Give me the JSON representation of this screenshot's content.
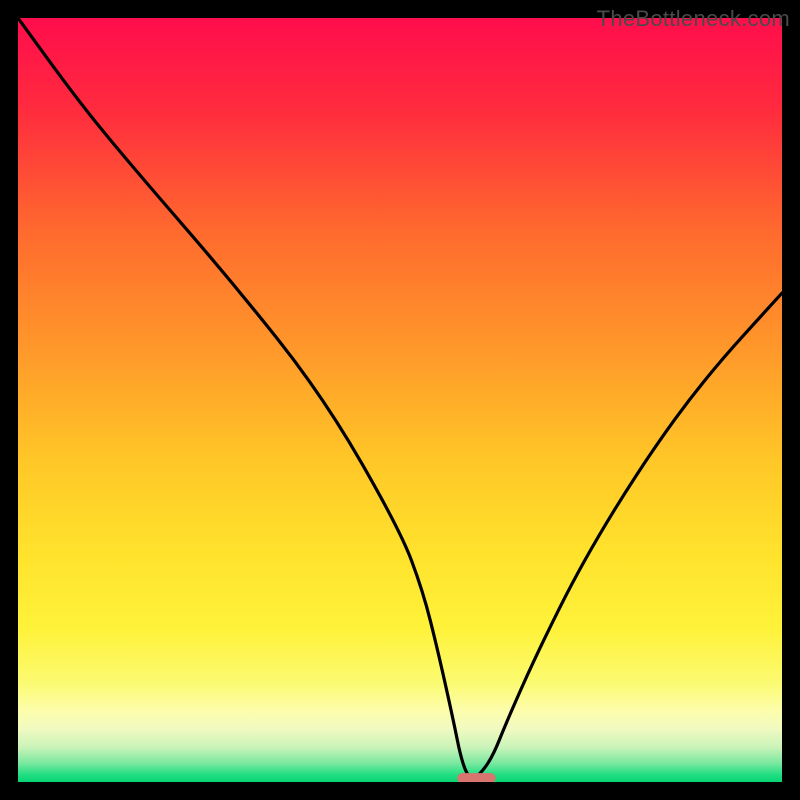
{
  "watermark": "TheBottleneck.com",
  "chart_data": {
    "type": "line",
    "title": "",
    "xlabel": "",
    "ylabel": "",
    "xlim": [
      0,
      100
    ],
    "ylim": [
      0,
      100
    ],
    "series": [
      {
        "name": "curve",
        "x": [
          0,
          8,
          15,
          28,
          40,
          50,
          53,
          55,
          57,
          58,
          59,
          60,
          62,
          64,
          68,
          74,
          82,
          90,
          100
        ],
        "values": [
          100,
          89,
          80.5,
          65.5,
          50.4,
          33,
          25,
          17,
          8,
          3,
          0.5,
          0.5,
          3,
          8,
          17,
          29,
          42,
          53,
          64
        ]
      },
      {
        "name": "flat-min-marker",
        "x": [
          58,
          62
        ],
        "values": [
          0.5,
          0.5
        ]
      }
    ],
    "gradient_stops": [
      {
        "offset": 0.0,
        "color": "#ff0d4c"
      },
      {
        "offset": 0.12,
        "color": "#ff2b3e"
      },
      {
        "offset": 0.28,
        "color": "#ff6a2e"
      },
      {
        "offset": 0.44,
        "color": "#ff9a2a"
      },
      {
        "offset": 0.58,
        "color": "#ffc727"
      },
      {
        "offset": 0.7,
        "color": "#ffe22c"
      },
      {
        "offset": 0.8,
        "color": "#fff23a"
      },
      {
        "offset": 0.87,
        "color": "#fbfb71"
      },
      {
        "offset": 0.905,
        "color": "#fdfdaa"
      },
      {
        "offset": 0.93,
        "color": "#f1fac0"
      },
      {
        "offset": 0.955,
        "color": "#c9f3b9"
      },
      {
        "offset": 0.975,
        "color": "#7ce9a0"
      },
      {
        "offset": 0.99,
        "color": "#23de83"
      },
      {
        "offset": 1.0,
        "color": "#07d574"
      }
    ],
    "marker_color": "#d9756f"
  }
}
